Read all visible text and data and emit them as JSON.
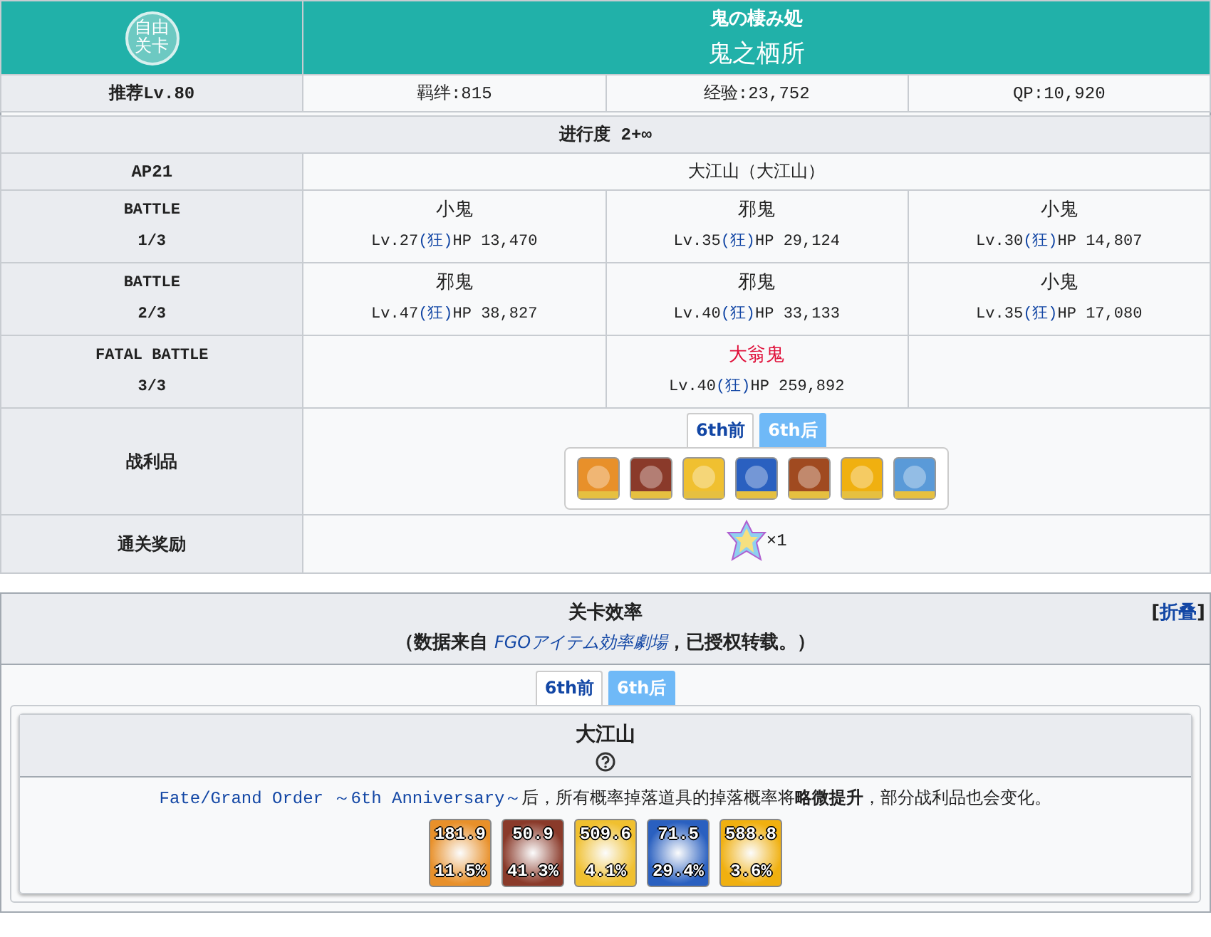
{
  "quest": {
    "badge": "自由关卡",
    "title_jp": "鬼の棲み処",
    "title_cn": "鬼之栖所",
    "recommend": "推荐Lv.80",
    "bond": "羁绊:815",
    "exp": "经验:23,752",
    "qp": "QP:10,920",
    "progress": "进行度 2+∞",
    "ap": "AP21",
    "location": "大江山（大江山）",
    "battles": [
      {
        "label": "BATTLE",
        "stage": "1/3",
        "enemies": [
          {
            "kind": "enemy",
            "name": "小鬼",
            "boss": false,
            "level": "Lv.27",
            "class": "(狂)",
            "hp": "HP 13,470"
          },
          {
            "kind": "enemy",
            "name": "邪鬼",
            "boss": false,
            "level": "Lv.35",
            "class": "(狂)",
            "hp": "HP 29,124"
          },
          {
            "kind": "enemy",
            "name": "小鬼",
            "boss": false,
            "level": "Lv.30",
            "class": "(狂)",
            "hp": "HP 14,807"
          }
        ]
      },
      {
        "label": "BATTLE",
        "stage": "2/3",
        "enemies": [
          {
            "kind": "enemy",
            "name": "邪鬼",
            "boss": false,
            "level": "Lv.47",
            "class": "(狂)",
            "hp": "HP 38,827"
          },
          {
            "kind": "enemy",
            "name": "邪鬼",
            "boss": false,
            "level": "Lv.40",
            "class": "(狂)",
            "hp": "HP 33,133"
          },
          {
            "kind": "enemy",
            "name": "小鬼",
            "boss": false,
            "level": "Lv.35",
            "class": "(狂)",
            "hp": "HP 17,080"
          }
        ]
      },
      {
        "label": "FATAL BATTLE",
        "stage": "3/3",
        "enemies": [
          {
            "kind": "empty"
          },
          {
            "kind": "enemy",
            "name": "大翁鬼",
            "boss": true,
            "level": "Lv.40",
            "class": "(狂)",
            "hp": "HP 259,892"
          },
          {
            "kind": "empty"
          }
        ]
      }
    ],
    "loot_label": "战利品",
    "loot_tabs": [
      {
        "label": "6th前",
        "selected": true
      },
      {
        "label": "6th后",
        "selected": false
      }
    ],
    "loot_items": [
      {
        "color": "#e8902a"
      },
      {
        "color": "#8a3a2a"
      },
      {
        "color": "#f0c030"
      },
      {
        "color": "#2a60c0"
      },
      {
        "color": "#a04a20"
      },
      {
        "color": "#f0b010"
      },
      {
        "color": "#5a9ad8"
      }
    ],
    "clear_label": "通关奖励",
    "clear_count": "×1"
  },
  "efficiency": {
    "title": "关卡效率",
    "source_before": "（数据来自 ",
    "source_link": "FGOアイテム効率劇場",
    "source_after": "，已授权转载。）",
    "toggle_before": "[",
    "toggle_link": "折叠",
    "toggle_after": "]",
    "tabs": [
      {
        "label": "6th前",
        "selected": true
      },
      {
        "label": "6th后",
        "selected": false
      }
    ],
    "quest_name": "大江山",
    "note_link": "Fate/Grand Order ～6th Anniversary～",
    "note_text": "后，所有概率掉落道具的掉落概率将**略微提升**，部分战利品也会变化。",
    "drops": [
      {
        "ap": "181.9",
        "rate": "11.5%",
        "color": "#e8902a"
      },
      {
        "ap": "50.9",
        "rate": "41.3%",
        "color": "#8a3a2a"
      },
      {
        "ap": "509.6",
        "rate": "4.1%",
        "color": "#f0c030"
      },
      {
        "ap": "71.5",
        "rate": "29.4%",
        "color": "#2a60c0"
      },
      {
        "ap": "588.8",
        "rate": "3.6%",
        "color": "#f0b010"
      }
    ]
  }
}
